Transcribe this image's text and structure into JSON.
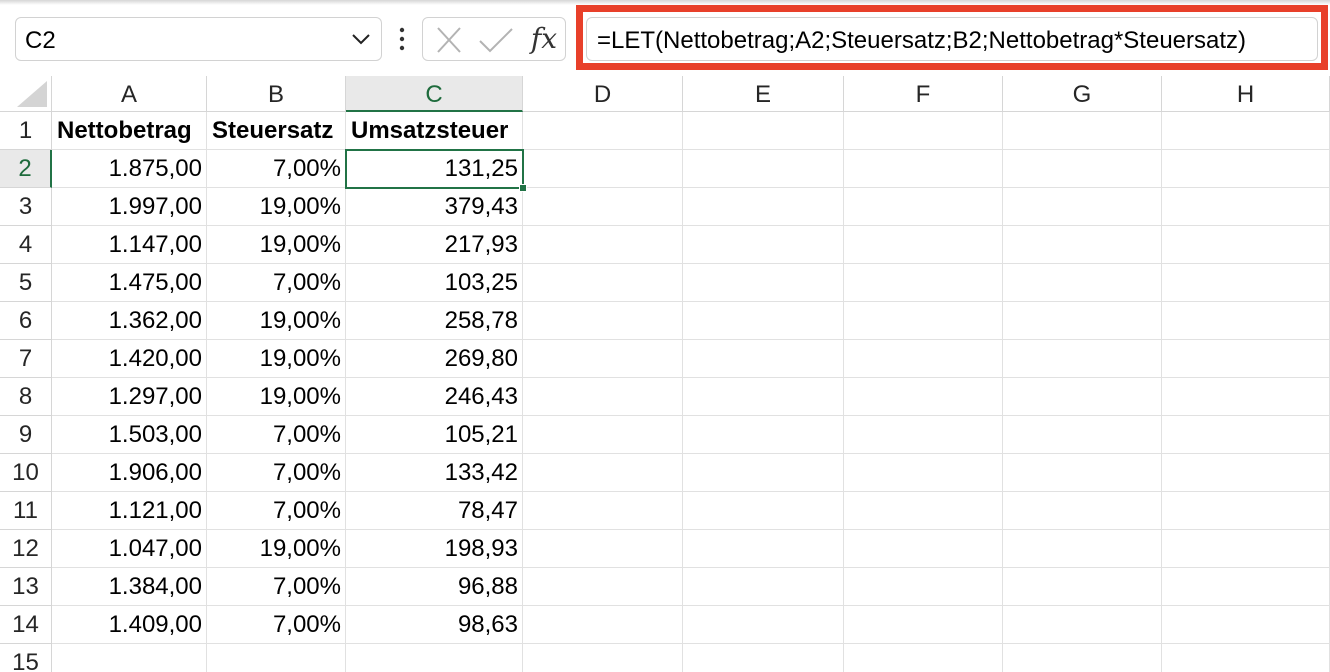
{
  "name_box": {
    "value": "C2"
  },
  "formula_bar": {
    "formula": "=LET(Nettobetrag;A2;Steuersatz;B2;Nettobetrag*Steuersatz)",
    "fx_label": "fx",
    "highlight_color": "#e8402a"
  },
  "active_cell": {
    "column": "C",
    "row": 2,
    "color": "#217346"
  },
  "columns": [
    "A",
    "B",
    "C",
    "D",
    "E",
    "F",
    "G",
    "H"
  ],
  "rows": [
    "1",
    "2",
    "3",
    "4",
    "5",
    "6",
    "7",
    "8",
    "9",
    "10",
    "11",
    "12",
    "13",
    "14",
    "15"
  ],
  "table": {
    "headers": [
      "Nettobetrag",
      "Steuersatz",
      "Umsatzsteuer"
    ],
    "rows": [
      [
        "1.875,00",
        "7,00%",
        "131,25"
      ],
      [
        "1.997,00",
        "19,00%",
        "379,43"
      ],
      [
        "1.147,00",
        "19,00%",
        "217,93"
      ],
      [
        "1.475,00",
        "7,00%",
        "103,25"
      ],
      [
        "1.362,00",
        "19,00%",
        "258,78"
      ],
      [
        "1.420,00",
        "19,00%",
        "269,80"
      ],
      [
        "1.297,00",
        "19,00%",
        "246,43"
      ],
      [
        "1.503,00",
        "7,00%",
        "105,21"
      ],
      [
        "1.906,00",
        "7,00%",
        "133,42"
      ],
      [
        "1.121,00",
        "7,00%",
        "78,47"
      ],
      [
        "1.047,00",
        "19,00%",
        "198,93"
      ],
      [
        "1.384,00",
        "7,00%",
        "96,88"
      ],
      [
        "1.409,00",
        "7,00%",
        "98,63"
      ]
    ]
  }
}
